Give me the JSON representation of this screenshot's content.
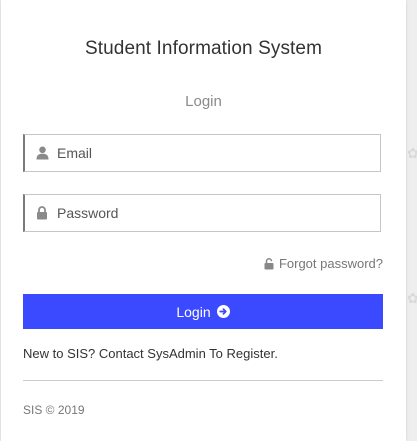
{
  "header": {
    "title": "Student Information System",
    "subtitle": "Login"
  },
  "form": {
    "email": {
      "placeholder": "Email",
      "value": "",
      "icon": "user-icon"
    },
    "password": {
      "placeholder": "Password",
      "value": "",
      "icon": "lock-icon"
    },
    "forgot_label": "Forgot password?",
    "forgot_icon": "unlock-icon",
    "login_label": "Login",
    "login_icon": "arrow-circle-right-icon"
  },
  "register_note": "New to SIS? Contact SysAdmin To Register.",
  "footer": {
    "copyright": "SIS © 2019"
  },
  "colors": {
    "accent": "#3b49ff",
    "background": "#eeeeee",
    "card": "#ffffff"
  }
}
